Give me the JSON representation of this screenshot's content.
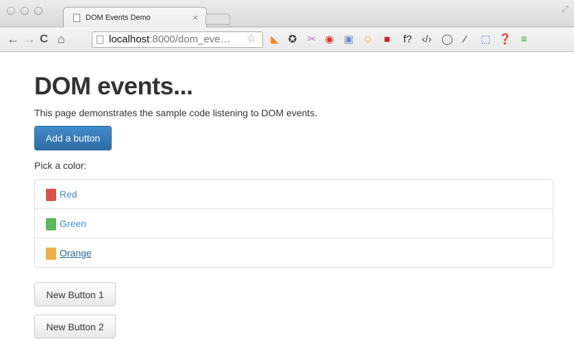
{
  "browser": {
    "tab_title": "DOM Events Demo",
    "tab_close": "×",
    "url_host": "localhost",
    "url_rest": ":8000/dom_eve…",
    "nav": {
      "back": "←",
      "forward": "→",
      "reload": "C",
      "home": "⌂"
    },
    "star": "☆",
    "extensions": [
      {
        "name": "rss-icon",
        "glyph": "◣",
        "color": "#f08a24"
      },
      {
        "name": "sync-icon",
        "glyph": "✪",
        "color": "#333333"
      },
      {
        "name": "scissors-icon",
        "glyph": "✂",
        "color": "#b77ac2"
      },
      {
        "name": "stop-icon",
        "glyph": "◉",
        "color": "#d9342b"
      },
      {
        "name": "calendar-icon",
        "glyph": "▣",
        "color": "#6a8fc9"
      },
      {
        "name": "face-icon",
        "glyph": "☺",
        "color": "#e8b53a"
      },
      {
        "name": "red-box-icon",
        "glyph": "■",
        "color": "#cc1f33"
      },
      {
        "name": "font-query-icon",
        "glyph": "f?",
        "color": "#222222"
      },
      {
        "name": "code-icon",
        "glyph": "‹/›",
        "color": "#444444"
      },
      {
        "name": "circle-icon",
        "glyph": "◯",
        "color": "#555555"
      },
      {
        "name": "eyedropper-icon",
        "glyph": "⁄",
        "color": "#333333"
      },
      {
        "name": "screenshot-icon",
        "glyph": "⬚",
        "color": "#2a78c4"
      },
      {
        "name": "help-icon",
        "glyph": "❓",
        "color": "#888888"
      },
      {
        "name": "menu-icon",
        "glyph": "≡",
        "color": "#3a9d3a"
      }
    ]
  },
  "page": {
    "heading": "DOM events...",
    "intro": "This page demonstrates the sample code listening to DOM events.",
    "add_button_label": "Add a button",
    "pick_label": "Pick a color:",
    "colors": [
      {
        "label": "Red",
        "swatch": "#d9534f"
      },
      {
        "label": "Green",
        "swatch": "#5cb85c"
      },
      {
        "label": "Orange",
        "swatch": "#f0ad4e"
      }
    ],
    "new_buttons": [
      "New Button 1",
      "New Button 2"
    ]
  }
}
